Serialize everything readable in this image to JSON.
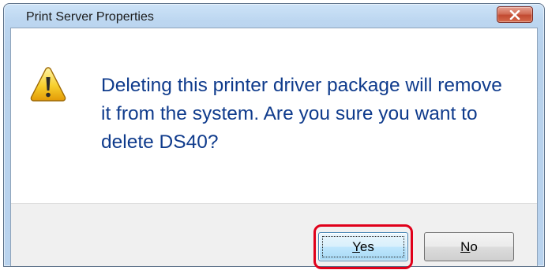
{
  "dialog": {
    "title": "Print Server Properties",
    "message": "Deleting this printer driver package will remove it from the system.  Are you sure you want to delete DS40?",
    "icon": "warning-icon",
    "buttons": {
      "yes": {
        "mnemonic": "Y",
        "rest": "es"
      },
      "no": {
        "mnemonic": "N",
        "rest": "o"
      }
    }
  },
  "colors": {
    "message_text": "#0f3b8c",
    "close_button": "#c24a32",
    "highlight": "#e0001a"
  }
}
